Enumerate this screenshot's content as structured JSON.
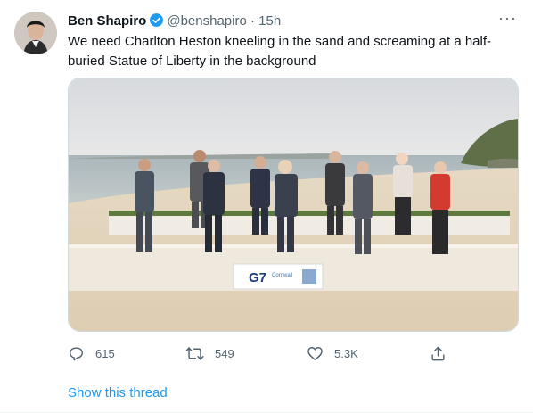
{
  "tweet": {
    "author_name": "Ben Shapiro",
    "handle": "@benshapiro",
    "separator": "·",
    "time": "15h",
    "text": "We need Charlton Heston kneeling in the sand and screaming at a half-buried Statue of Liberty in the background",
    "media": {
      "banner_title": "G7",
      "banner_subtitle": "Cornwall"
    },
    "actions": {
      "replies": "615",
      "retweets": "549",
      "likes": "5.3K"
    },
    "show_thread": "Show this thread"
  },
  "colors": {
    "accent": "#1d9bf0",
    "secondary_text": "#536471",
    "primary_text": "#0f1419",
    "verified": "#1d9bf0"
  },
  "icons": {
    "verified": "verified-badge-icon",
    "more": "more-options-icon",
    "reply": "reply-icon",
    "retweet": "retweet-icon",
    "like": "like-icon",
    "share": "share-icon"
  }
}
